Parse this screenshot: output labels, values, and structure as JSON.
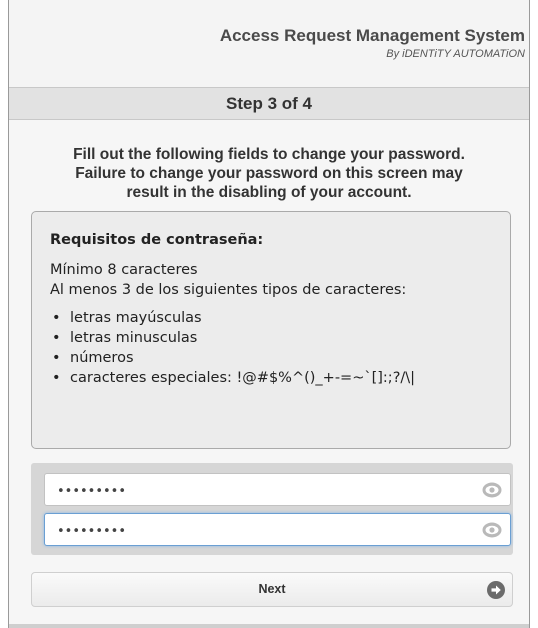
{
  "header": {
    "title": "Access Request Management System",
    "subtitle": "By iDENTiTY AUTOMATiON"
  },
  "step": {
    "label": "Step 3 of 4"
  },
  "instructions": {
    "lines": [
      "Fill out the following fields to change your password.",
      "Failure to change your password on this screen may",
      "result in the disabling of your account."
    ]
  },
  "requirements": {
    "title": "Requisitos de contraseña:",
    "min_length": "Mínimo 8 caracteres",
    "at_least": "Al menos 3 de los siguientes tipos de caracteres:",
    "bullet": "•",
    "items": [
      "letras mayúsculas",
      "letras minusculas",
      "números",
      "caracteres especiales:  !@#$%^()_+-=~`[]:;?/\\|"
    ]
  },
  "password_fields": [
    {
      "value": "•••••••••",
      "show_icon": "eye-icon",
      "focused": false
    },
    {
      "value": "•••••••••",
      "show_icon": "eye-icon",
      "focused": true
    }
  ],
  "next_button": {
    "label": "Next",
    "icon": "arrow-right-circle-icon"
  },
  "colors": {
    "focus_border": "#6a9fd3",
    "panel": "#d6d6d6",
    "step_bar": "#e2e2e2"
  }
}
